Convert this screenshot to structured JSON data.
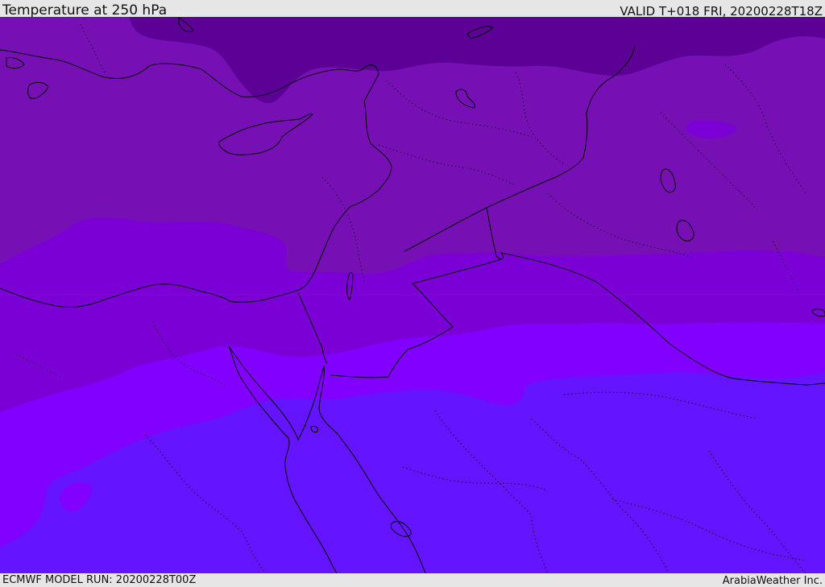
{
  "header": {
    "title": "Temperature at 250 hPa",
    "valid_time": "VALID T+018 FRI, 20200228T18Z"
  },
  "footer": {
    "model_run": "ECMWF MODEL RUN: 20200228T00Z",
    "credit": "ArabiaWeather Inc."
  },
  "map": {
    "colors": {
      "band_coldest": "#5c0096",
      "band_cold": "#7610b4",
      "band_mid": "#7b00d6",
      "band_warm": "#8200ff",
      "band_warmest": "#6414ff",
      "coastline": "#000000",
      "border": "#000000"
    }
  }
}
